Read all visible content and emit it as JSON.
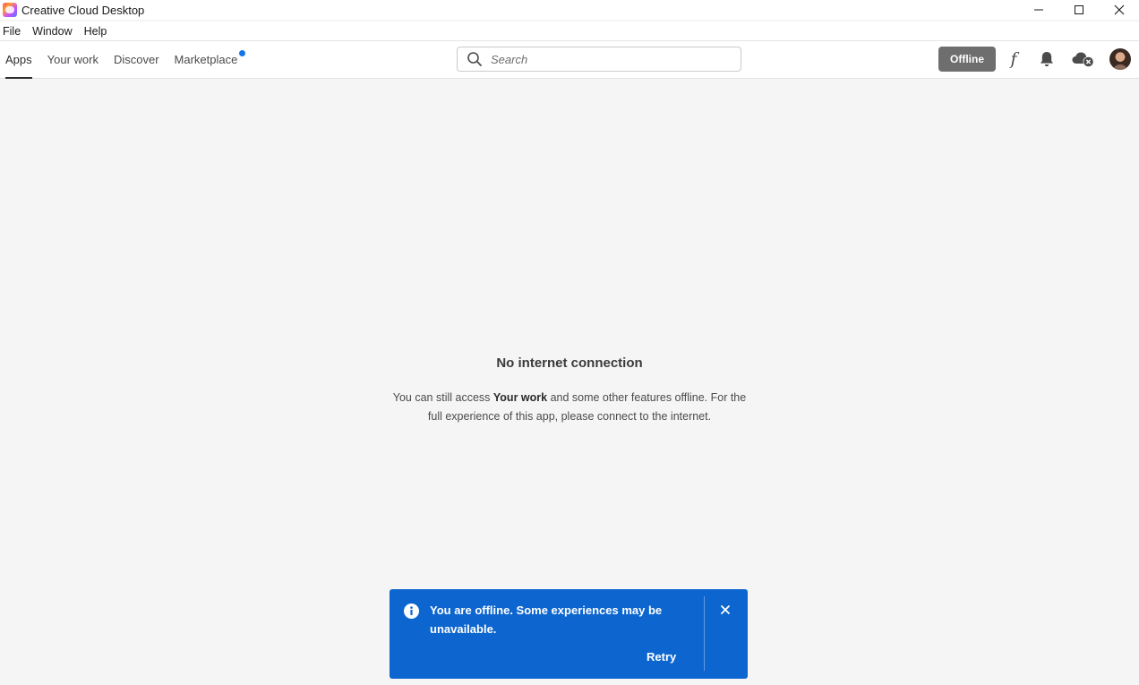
{
  "window": {
    "title": "Creative Cloud Desktop",
    "controls": [
      "minimize-icon",
      "maximize-icon",
      "close-icon"
    ]
  },
  "menu": {
    "items": [
      "File",
      "Window",
      "Help"
    ]
  },
  "nav": {
    "tabs": [
      {
        "label": "Apps",
        "active": true
      },
      {
        "label": "Your work",
        "active": false
      },
      {
        "label": "Discover",
        "active": false
      },
      {
        "label": "Marketplace",
        "active": false,
        "has_dot": true
      }
    ],
    "search_placeholder": "Search",
    "offline_label": "Offline",
    "font_icon_glyph": "f"
  },
  "main": {
    "heading": "No internet connection",
    "message_part1": "You can still access ",
    "message_bold": "Your work",
    "message_part2": " and some other features offline. For the full experience of this app, please connect to the internet."
  },
  "toast": {
    "message": "You are offline. Some experiences may be unavailable.",
    "action_label": "Retry"
  },
  "colors": {
    "accent_blue": "#0d66d0",
    "notification_dot": "#1473e6",
    "offline_badge": "#6e6e6e",
    "background": "#f5f5f5"
  }
}
